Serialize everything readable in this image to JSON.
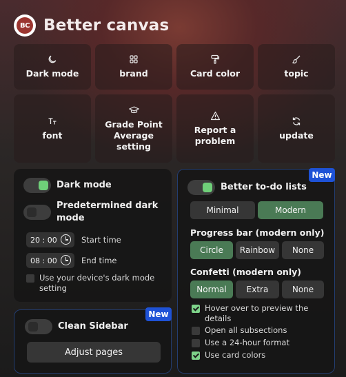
{
  "header": {
    "logo_text": "BC",
    "title": "Better canvas"
  },
  "tiles": [
    {
      "icon": "moon-icon",
      "label": "Dark mode"
    },
    {
      "icon": "grid-icon",
      "label": "brand"
    },
    {
      "icon": "paint-roller-icon",
      "label": "Card color"
    },
    {
      "icon": "brush-icon",
      "label": "topic"
    },
    {
      "icon": "text-size-icon",
      "label": "font"
    },
    {
      "icon": "graduation-cap-icon",
      "label": "Grade Point Average setting"
    },
    {
      "icon": "warning-icon",
      "label": "Report a problem"
    },
    {
      "icon": "refresh-icon",
      "label": "update"
    }
  ],
  "dark_mode_card": {
    "dark_mode_label": "Dark mode",
    "dark_mode_on": true,
    "predetermined_label": "Predetermined dark mode",
    "predetermined_on": false,
    "start_time": "20 : 00",
    "start_label": "Start time",
    "end_time": "08 : 00",
    "end_label": "End time",
    "device_label": "Use your device's dark mode setting",
    "device_checked": false
  },
  "sidebar_card": {
    "badge": "New",
    "label": "Clean Sidebar",
    "on": false,
    "adjust_button": "Adjust pages"
  },
  "todo_card": {
    "badge": "New",
    "label": "Better to-do lists",
    "on": true,
    "style_options": [
      "Minimal",
      "Modern"
    ],
    "style_selected": "Modern",
    "progress_label": "Progress bar (modern only)",
    "progress_options": [
      "Circle",
      "Rainbow",
      "None"
    ],
    "progress_selected": "Circle",
    "confetti_label": "Confetti (modern only)",
    "confetti_options": [
      "Normal",
      "Extra",
      "None"
    ],
    "confetti_selected": "Normal",
    "checks": [
      {
        "label": "Hover over to preview the details",
        "checked": true
      },
      {
        "label": "Open all subsections",
        "checked": false
      },
      {
        "label": "Use a 24-hour format",
        "checked": false
      },
      {
        "label": "Use card colors",
        "checked": true
      }
    ]
  },
  "colors": {
    "accent_green": "#6fcf79",
    "badge_blue": "#1e52d6",
    "selected_segment": "#4a7a55"
  }
}
